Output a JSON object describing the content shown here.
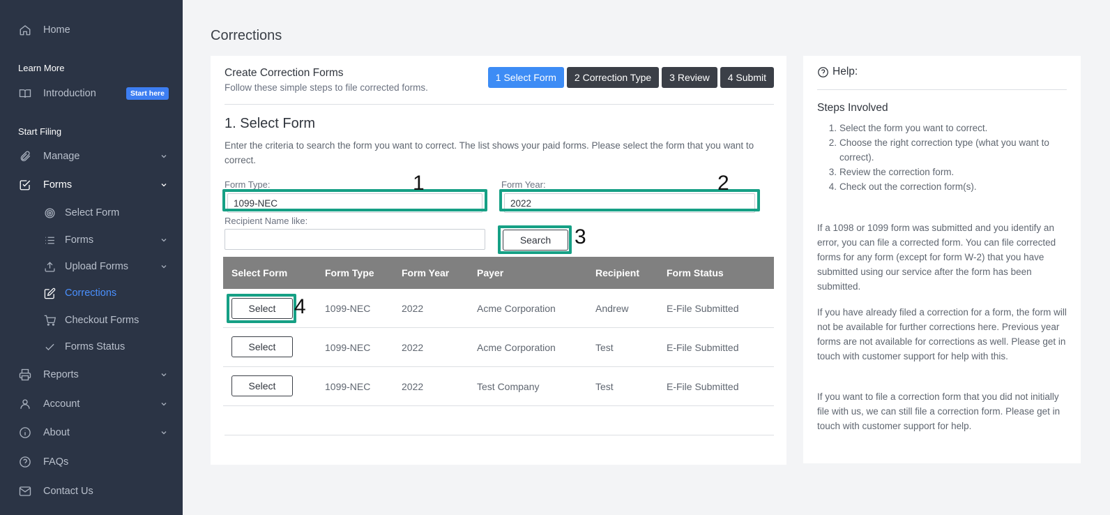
{
  "sidebar": {
    "home": "Home",
    "learn_more": "Learn More",
    "introduction": "Introduction",
    "start_here_badge": "Start here",
    "start_filing": "Start Filing",
    "manage": "Manage",
    "forms": "Forms",
    "sub": {
      "select_form": "Select Form",
      "forms": "Forms",
      "upload_forms": "Upload Forms",
      "corrections": "Corrections",
      "checkout_forms": "Checkout Forms",
      "forms_status": "Forms Status"
    },
    "reports": "Reports",
    "account": "Account",
    "about": "About",
    "faqs": "FAQs",
    "contact_us": "Contact Us"
  },
  "page": {
    "title": "Corrections"
  },
  "main": {
    "card_title": "Create Correction Forms",
    "card_subtitle": "Follow these simple steps to file corrected forms.",
    "steps": [
      "1 Select Form",
      "2 Correction Type",
      "3 Review",
      "4 Submit"
    ],
    "section_title": "1. Select Form",
    "section_desc": "Enter the criteria to search the form you want to correct. The list shows your paid forms. Please select the form that you want to correct.",
    "form_type_label": "Form Type:",
    "form_type_value": "1099-NEC",
    "form_year_label": "Form Year:",
    "form_year_value": "2022",
    "recipient_label": "Recipient Name like:",
    "recipient_value": "",
    "search_button": "Search",
    "annotations": [
      "1",
      "2",
      "3",
      "4"
    ],
    "table": {
      "columns": [
        "Select Form",
        "Form Type",
        "Form Year",
        "Payer",
        "Recipient",
        "Form Status"
      ],
      "select_label": "Select",
      "rows": [
        [
          "1099-NEC",
          "2022",
          "Acme Corporation",
          "Andrew",
          "E-File Submitted"
        ],
        [
          "1099-NEC",
          "2022",
          "Acme Corporation",
          "Test",
          "E-File Submitted"
        ],
        [
          "1099-NEC",
          "2022",
          "Test Company",
          "Test",
          "E-File Submitted"
        ]
      ]
    }
  },
  "help": {
    "title": "Help:",
    "steps_title": "Steps Involved",
    "steps": [
      {
        "num": "1.",
        "text": "Select the form you want to correct."
      },
      {
        "num": "2.",
        "text": "Choose the right correction type (what you want to correct)."
      },
      {
        "num": "3.",
        "text": "Review the correction form."
      },
      {
        "num": "4.",
        "text": "Check out the correction form(s)."
      }
    ],
    "p1": "If a 1098 or 1099 form was submitted and you identify an error, you can file a corrected form. You can file corrected forms for any form (except for form W-2) that you have submitted using our service after the form has been submitted.",
    "p2": "If you have already filed a correction for a form, the form will not be available for further corrections here. Previous year forms are not available for corrections as well. Please get in touch with customer support for help with this.",
    "p3": "If you want to file a correction form that you did not initially file with us, we can still file a correction form. Please get in touch with customer support for help."
  },
  "colors": {
    "sidebar_bg": "#2b3445",
    "accent": "#3d8cf5",
    "highlight": "#16a085",
    "table_header": "#808080"
  }
}
